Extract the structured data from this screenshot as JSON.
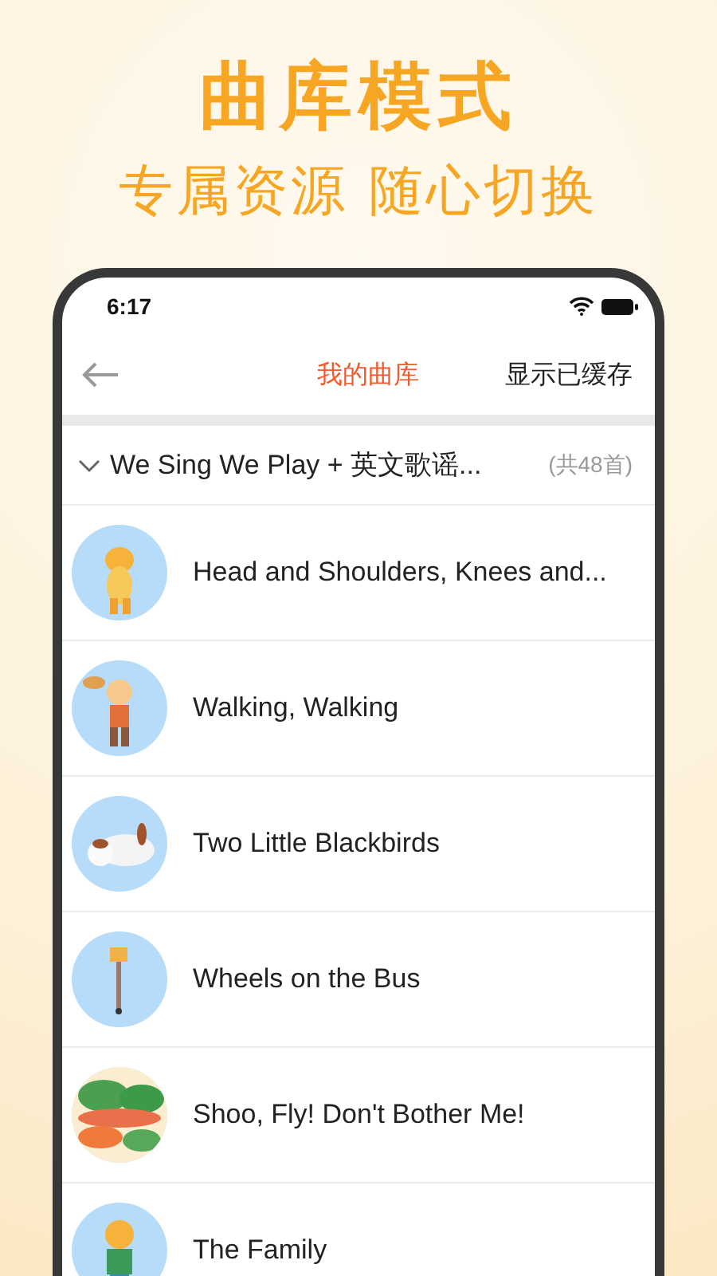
{
  "promo": {
    "title": "曲库模式",
    "subtitle": "专属资源 随心切换"
  },
  "status_bar": {
    "time": "6:17"
  },
  "nav": {
    "title": "我的曲库",
    "action": "显示已缓存"
  },
  "group": {
    "title": "We Sing We Play + 英文歌谣...",
    "count": "(共48首)",
    "expanded": true
  },
  "songs": [
    {
      "title": "Head and Shoulders, Knees and..."
    },
    {
      "title": "Walking, Walking"
    },
    {
      "title": "Two Little Blackbirds"
    },
    {
      "title": "Wheels on the Bus"
    },
    {
      "title": "Shoo, Fly! Don't Bother Me!"
    },
    {
      "title": "The Family"
    }
  ]
}
